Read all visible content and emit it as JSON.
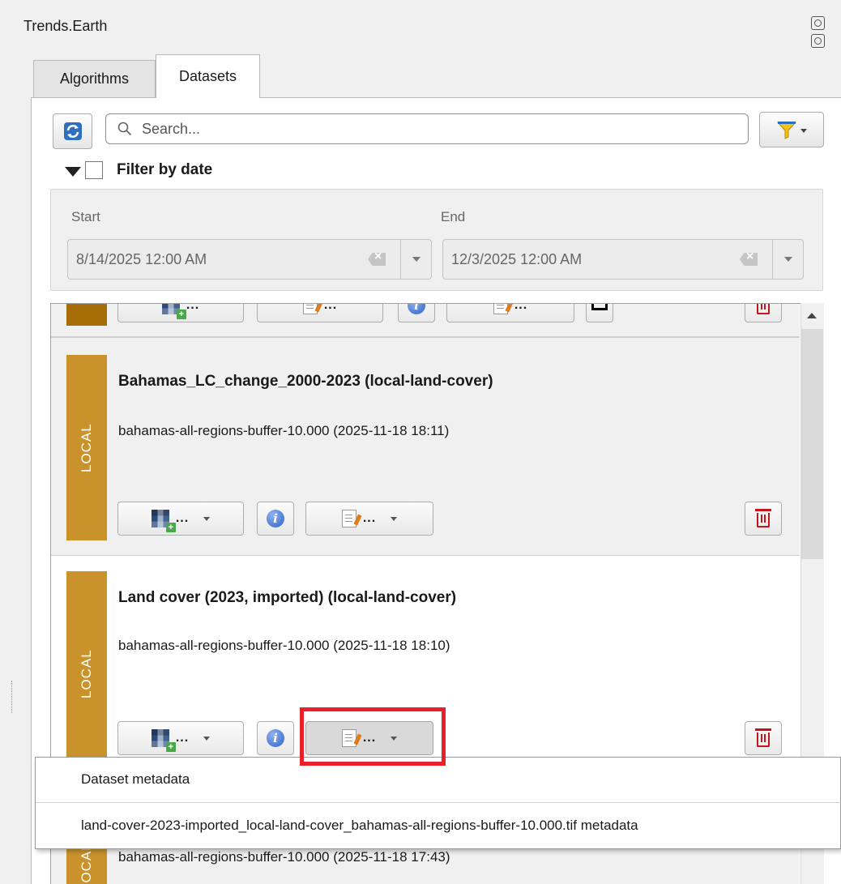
{
  "panel": {
    "title": "Trends.Earth"
  },
  "tabs": [
    {
      "label": "Algorithms",
      "active": false
    },
    {
      "label": "Datasets",
      "active": true
    }
  ],
  "search": {
    "placeholder": "Search...",
    "value": ""
  },
  "date_filter": {
    "label": "Filter by date",
    "checked": false,
    "start_label": "Start",
    "end_label": "End",
    "start_value": "8/14/2025 12:00 AM",
    "end_value": "12/3/2025 12:00 AM"
  },
  "datasets": [
    {
      "badge": "LOCAL",
      "title": "Bahamas_LC_change_2000-2023 (local-land-cover)",
      "subtitle": "bahamas-all-regions-buffer-10.000 (2025-11-18 18:11)",
      "add_label": "...",
      "metadata_label": "..."
    },
    {
      "badge": "LOCAL",
      "title": "Land cover (2023, imported) (local-land-cover)",
      "subtitle": "bahamas-all-regions-buffer-10.000 (2025-11-18 18:10)",
      "add_label": "...",
      "metadata_label": "..."
    },
    {
      "badge": "LOCAL",
      "title": "",
      "subtitle": "bahamas-all-regions-buffer-10.000 (2025-11-18 17:43)"
    }
  ],
  "partial_top_card": {
    "dots": "..."
  },
  "metadata_menu": {
    "items": [
      "Dataset metadata",
      "land-cover-2023-imported_local-land-cover_bahamas-all-regions-buffer-10.000.tif metadata"
    ]
  },
  "colors": {
    "local_badge": "#c9922b",
    "delete_icon": "#c4161c",
    "highlight": "#e8202a"
  }
}
